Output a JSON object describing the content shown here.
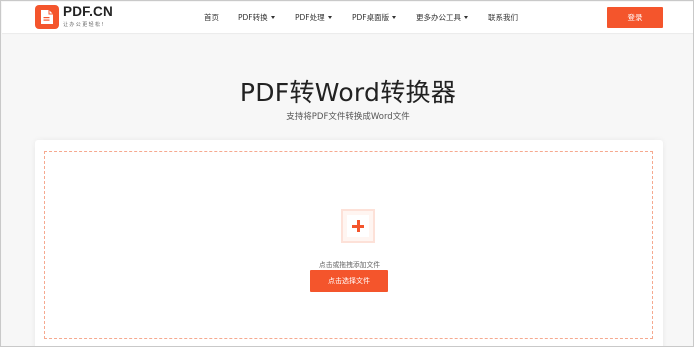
{
  "brand": {
    "name": "PDF.CN",
    "slogan": "让办公更轻松!",
    "accent_color": "#f4552c",
    "logo_icon": "pdf-logo-icon"
  },
  "nav": {
    "items": [
      {
        "label": "首页",
        "has_dropdown": false
      },
      {
        "label": "PDF转换",
        "has_dropdown": true
      },
      {
        "label": "PDF处理",
        "has_dropdown": true
      },
      {
        "label": "PDF桌面版",
        "has_dropdown": true
      },
      {
        "label": "更多办公工具",
        "has_dropdown": true
      },
      {
        "label": "联系我们",
        "has_dropdown": false
      }
    ],
    "dropdown_icon": "caret-down-icon",
    "login_label": "登录"
  },
  "hero": {
    "title": "PDF转Word转换器",
    "subtitle": "支持将PDF文件转换成Word文件"
  },
  "upload": {
    "add_icon": "plus-icon",
    "hint": "点击或拖拽添加文件",
    "button_label": "点击选择文件"
  }
}
